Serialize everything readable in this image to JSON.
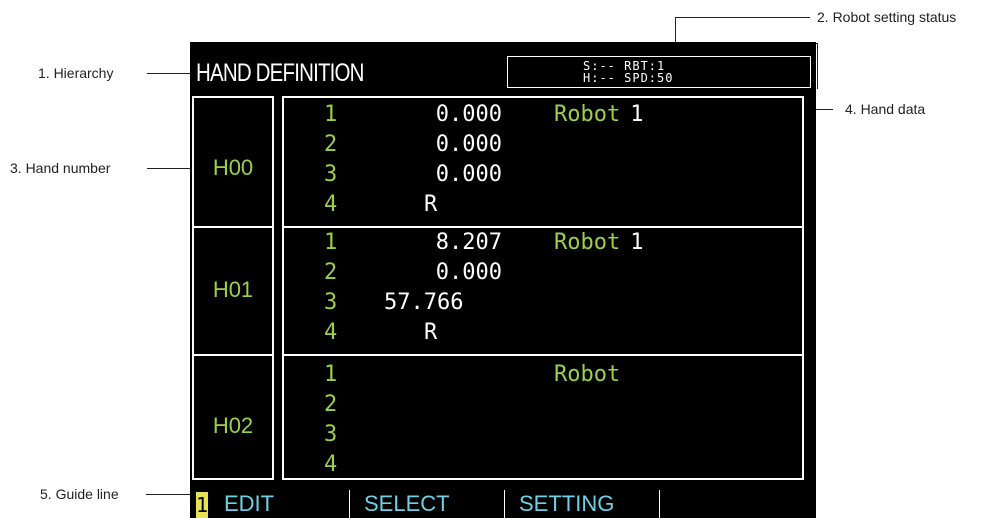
{
  "callouts": {
    "hierarchy": "1. Hierarchy",
    "robot_setting_status": "2. Robot setting status",
    "hand_number": "3. Hand number",
    "hand_data": "4. Hand data",
    "guide_line": "5. Guide line"
  },
  "screen": {
    "hierarchy": "HAND DEFINITION",
    "status": {
      "line1": "S:-- RBT:1",
      "line2": "H:-- SPD:50"
    },
    "hands": [
      {
        "number": "H00",
        "rows": [
          {
            "idx": "1",
            "value": "0.000"
          },
          {
            "idx": "2",
            "value": "0.000"
          },
          {
            "idx": "3",
            "value": "0.000"
          },
          {
            "idx": "4",
            "value": "R"
          }
        ],
        "robot_label": "Robot",
        "robot_num": "1"
      },
      {
        "number": "H01",
        "rows": [
          {
            "idx": "1",
            "value": "8.207"
          },
          {
            "idx": "2",
            "value": "0.000"
          },
          {
            "idx": "3",
            "value": "57.766"
          },
          {
            "idx": "4",
            "value": "R"
          }
        ],
        "robot_label": "Robot",
        "robot_num": "1"
      },
      {
        "number": "H02",
        "rows": [
          {
            "idx": "1",
            "value": ""
          },
          {
            "idx": "2",
            "value": ""
          },
          {
            "idx": "3",
            "value": ""
          },
          {
            "idx": "4",
            "value": ""
          }
        ],
        "robot_label": "Robot",
        "robot_num": ""
      }
    ],
    "guide": {
      "page": "1",
      "keys": [
        "EDIT",
        "SELECT",
        "SETTING"
      ]
    },
    "colors": {
      "screen_bg": "#000000",
      "label_green": "#9ad04a",
      "key_cyan": "#6fd0e6",
      "badge_yellow": "#e8e25a"
    }
  }
}
